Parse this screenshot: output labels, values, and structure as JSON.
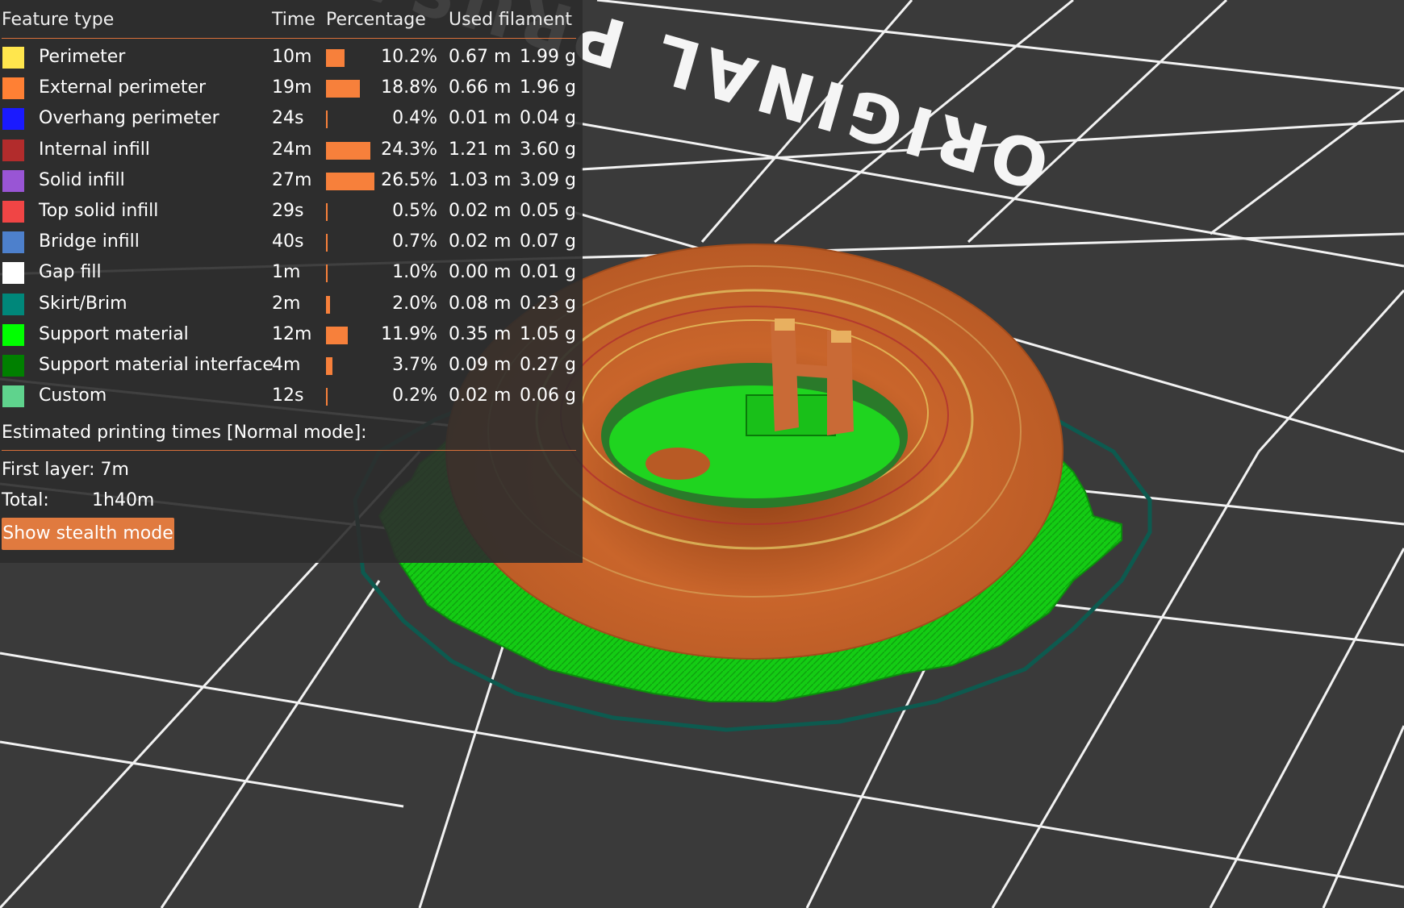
{
  "bed_text": "ORIGINAL PRUSA",
  "legend": {
    "headers": {
      "feature_type": "Feature type",
      "time": "Time",
      "percentage": "Percentage",
      "used_filament": "Used filament"
    },
    "rows": [
      {
        "name": "Perimeter",
        "time": "10m",
        "percent": "10.2%",
        "percent_value": 10.2,
        "length": "0.67 m",
        "weight": "1.99 g",
        "color": "#ffe64d"
      },
      {
        "name": "External perimeter",
        "time": "19m",
        "percent": "18.8%",
        "percent_value": 18.8,
        "length": "0.66 m",
        "weight": "1.96 g",
        "color": "#ff8034"
      },
      {
        "name": "Overhang perimeter",
        "time": "24s",
        "percent": "0.4%",
        "percent_value": 0.4,
        "length": "0.01 m",
        "weight": "0.04 g",
        "color": "#1a1aff"
      },
      {
        "name": "Internal infill",
        "time": "24m",
        "percent": "24.3%",
        "percent_value": 24.3,
        "length": "1.21 m",
        "weight": "3.60 g",
        "color": "#b22c2c"
      },
      {
        "name": "Solid infill",
        "time": "27m",
        "percent": "26.5%",
        "percent_value": 26.5,
        "length": "1.03 m",
        "weight": "3.09 g",
        "color": "#9955d5"
      },
      {
        "name": "Top solid infill",
        "time": "29s",
        "percent": "0.5%",
        "percent_value": 0.5,
        "length": "0.02 m",
        "weight": "0.05 g",
        "color": "#f04545"
      },
      {
        "name": "Bridge infill",
        "time": "40s",
        "percent": "0.7%",
        "percent_value": 0.7,
        "length": "0.02 m",
        "weight": "0.07 g",
        "color": "#4d80cc"
      },
      {
        "name": "Gap fill",
        "time": "1m",
        "percent": "1.0%",
        "percent_value": 1.0,
        "length": "0.00 m",
        "weight": "0.01 g",
        "color": "#ffffff"
      },
      {
        "name": "Skirt/Brim",
        "time": "2m",
        "percent": "2.0%",
        "percent_value": 2.0,
        "length": "0.08 m",
        "weight": "0.23 g",
        "color": "#00877a"
      },
      {
        "name": "Support material",
        "time": "12m",
        "percent": "11.9%",
        "percent_value": 11.9,
        "length": "0.35 m",
        "weight": "1.05 g",
        "color": "#00ff00"
      },
      {
        "name": "Support material interface",
        "time": "4m",
        "percent": "3.7%",
        "percent_value": 3.7,
        "length": "0.09 m",
        "weight": "0.27 g",
        "color": "#008000"
      },
      {
        "name": "Custom",
        "time": "12s",
        "percent": "0.2%",
        "percent_value": 0.2,
        "length": "0.02 m",
        "weight": "0.06 g",
        "color": "#5fd38d"
      }
    ],
    "estimated_title": "Estimated printing times [Normal mode]:",
    "first_layer_label": "First layer:",
    "first_layer_value": "7m",
    "total_label": "Total:",
    "total_value": "1h40m",
    "stealth_button": "Show stealth mode"
  },
  "colors": {
    "accent": "#e07a3f",
    "bar": "#f7803b",
    "model": "#c9652b",
    "support": "#14cc14",
    "skirt": "#0d5a4f",
    "bed": "#3a3a3a"
  }
}
